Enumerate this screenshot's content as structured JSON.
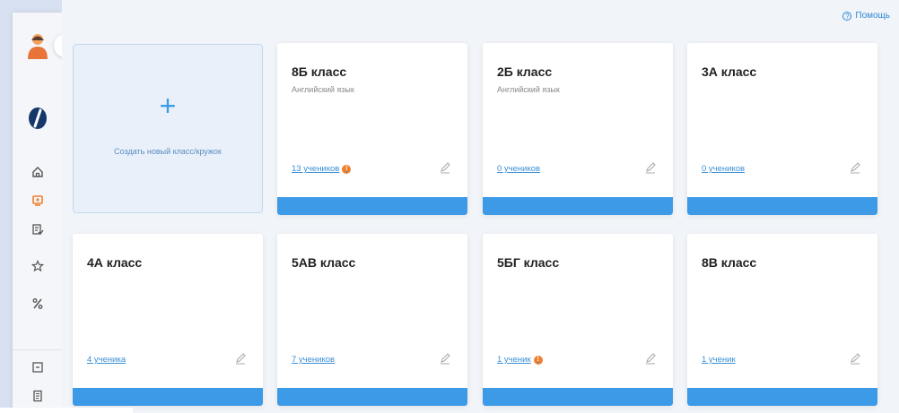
{
  "help": {
    "label": "Помощь"
  },
  "create": {
    "plus": "+",
    "label": "Создать новый класс/кружок"
  },
  "colors": {
    "accent": "#3d9ae6",
    "badge": "#f07f2d",
    "background": "#d7e1f1"
  },
  "sidebar": {
    "expand_glyph": "›",
    "icons": [
      "home-icon",
      "classes-icon",
      "tasks-icon",
      "star-icon",
      "percent-icon",
      "box-icon",
      "document-icon"
    ]
  },
  "classes": [
    {
      "title": "8Б класс",
      "subject": "Английский язык",
      "students": "13 учеников",
      "badge": "!"
    },
    {
      "title": "2Б класс",
      "subject": "Английский язык",
      "students": "0 учеников",
      "badge": ""
    },
    {
      "title": "3А класс",
      "subject": "",
      "students": "0 учеников",
      "badge": ""
    },
    {
      "title": "4А класс",
      "subject": "",
      "students": "4 ученика",
      "badge": ""
    },
    {
      "title": "5АВ класс",
      "subject": "",
      "students": "7 учеников",
      "badge": ""
    },
    {
      "title": "5БГ класс",
      "subject": "",
      "students": "1 ученик",
      "badge": "!"
    },
    {
      "title": "8В класс",
      "subject": "",
      "students": "1 ученик",
      "badge": ""
    }
  ]
}
